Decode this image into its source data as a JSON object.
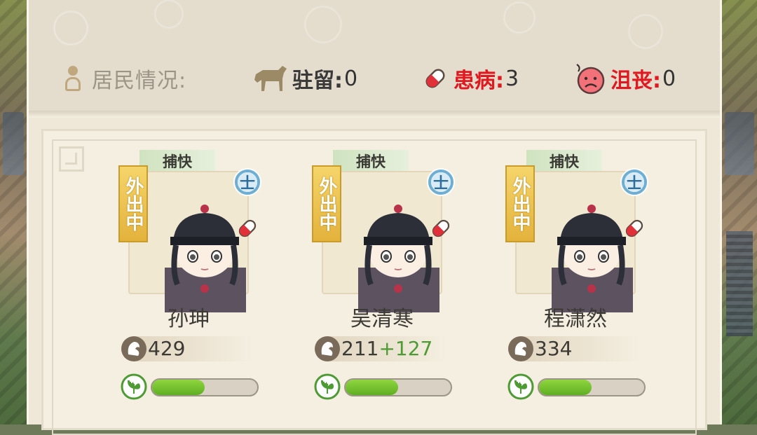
{
  "status": {
    "title": "居民情况:",
    "stationed": {
      "label": "驻留:",
      "value": "0",
      "color": "#3a3a3a"
    },
    "sick": {
      "label": "患病:",
      "value": "3",
      "color": "#e0181f"
    },
    "depressed": {
      "label": "沮丧:",
      "value": "0",
      "color": "#e0181f"
    }
  },
  "residents": [
    {
      "role": "捕快",
      "status_badge": "外出中",
      "rank": "士",
      "name": "孙珅",
      "strength": "429",
      "strength_bonus": "",
      "health": 0.5
    },
    {
      "role": "捕快",
      "status_badge": "外出中",
      "rank": "士",
      "name": "吴清寒",
      "strength": "211",
      "strength_bonus": "+127",
      "health": 0.5
    },
    {
      "role": "捕快",
      "status_badge": "外出中",
      "rank": "士",
      "name": "程潇然",
      "strength": "334",
      "strength_bonus": "",
      "health": 0.5
    }
  ],
  "colors": {
    "health_fill": "#6cc22b",
    "accent_red": "#e0181f",
    "rank_blue": "#6faed3",
    "badge_gold": "#e3b23c"
  }
}
